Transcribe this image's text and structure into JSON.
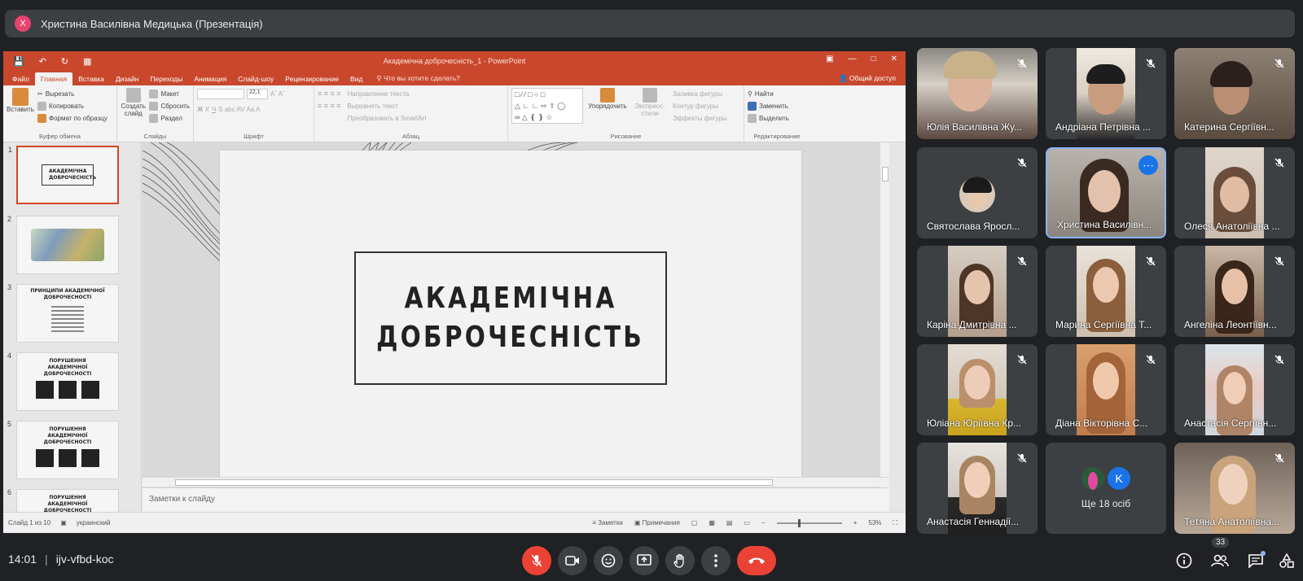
{
  "meet": {
    "presenter_initial": "Х",
    "presentation_title": "Христина Василівна Медицька (Презентація)",
    "time": "14:01",
    "separator": "|",
    "meeting_code": "ijv-vfbd-koc",
    "participants_count": "33",
    "others_label": "Ще 18 осіб",
    "others_initial": "K",
    "participants": [
      {
        "name": "Юлія Василівна Жу..."
      },
      {
        "name": "Андріана Петрівна ..."
      },
      {
        "name": "Катерина Сергіївн..."
      },
      {
        "name": "Святослава Яросл..."
      },
      {
        "name": "Христина Василівн..."
      },
      {
        "name": "Олеся Анатоліївна ..."
      },
      {
        "name": "Каріна Дмитрівна ..."
      },
      {
        "name": "Марина Сергіївна Т..."
      },
      {
        "name": "Ангеліна Леонтіївн..."
      },
      {
        "name": "Юліана Юріївна Кр..."
      },
      {
        "name": "Діана Вікторівна С..."
      },
      {
        "name": "Анастасія Сергіївн..."
      },
      {
        "name": "Анастасія Геннадії..."
      },
      {
        "name": "Тетяна Анатоліївна..."
      }
    ],
    "colors": {
      "accent": "#8ab4f8",
      "end_call": "#ea4335",
      "tile_bg": "#3c4043",
      "bg": "#202124"
    }
  },
  "ppt": {
    "window_title": "Академічна доброчесність_1 - PowerPoint",
    "tabs": [
      "Файл",
      "Главная",
      "Вставка",
      "Дизайн",
      "Переходы",
      "Анимация",
      "Слайд-шоу",
      "Рецензирование",
      "Вид"
    ],
    "search_placeholder": "Что вы хотите сделать?",
    "share": "Общий доступ",
    "ribbon": {
      "paste": "Вставить",
      "cut": "Вырезать",
      "copy": "Копировать",
      "format_painter": "Формат по образцу",
      "clipboard_group": "Буфер обмена",
      "new_slide": "Создать слайд",
      "layout": "Макет",
      "reset": "Сбросить",
      "section": "Раздел",
      "slides_group": "Слайды",
      "font_size": "22,1",
      "font_group": "Шрифт",
      "text_direction": "Направление текста",
      "align_text": "Выровнять текст",
      "smartart": "Преобразовать в SmartArt",
      "paragraph_group": "Абзац",
      "arrange": "Упорядочить",
      "quick_styles": "Экспресс-стили",
      "shape_fill": "Заливка фигуры",
      "shape_outline": "Контур фигуры",
      "shape_effects": "Эффекты фигуры",
      "drawing_group": "Рисование",
      "find": "Найти",
      "replace": "Заменить",
      "select": "Выделить",
      "editing_group": "Редактирование"
    },
    "slide_title_line1": "АКАДЕМІЧНА",
    "slide_title_line2": "ДОБРОЧЕСНІСТЬ",
    "thumbnails": [
      {
        "num": "1",
        "title": "АКАДЕМІЧНА ДОБРОЧЕСНІСТЬ"
      },
      {
        "num": "2",
        "title": ""
      },
      {
        "num": "3",
        "title": "ПРИНЦИПИ АКАДЕМІЧНОЇ ДОБРОЧЕСНОСТІ"
      },
      {
        "num": "4",
        "title": "ПОРУШЕННЯ АКАДЕМІЧНОЇ ДОБРОЧЕСНОСТІ"
      },
      {
        "num": "5",
        "title": "ПОРУШЕННЯ АКАДЕМІЧНОЇ ДОБРОЧЕСНОСТІ"
      },
      {
        "num": "6",
        "title": "ПОРУШЕННЯ АКАДЕМІЧНОЇ ДОБРОЧЕСНОСТІ"
      }
    ],
    "notes_placeholder": "Заметки к слайду",
    "status_slide": "Слайд 1 из 10",
    "status_lang": "украинский",
    "status_notes": "Заметки",
    "status_comments": "Примечания",
    "zoom": "53%",
    "colors": {
      "accent": "#c9482d",
      "selected_thumb": "#d24726"
    }
  }
}
